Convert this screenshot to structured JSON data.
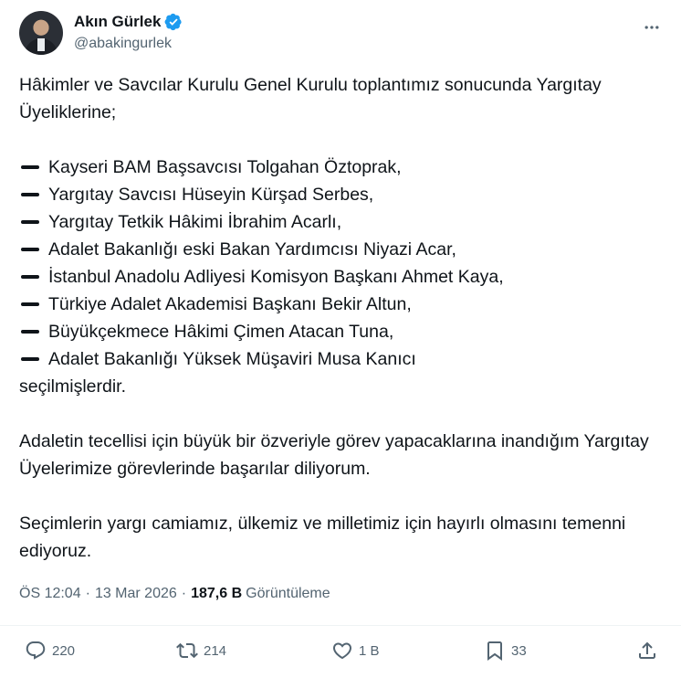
{
  "author": {
    "name": "Akın Gürlek",
    "handle": "@abakingurlek",
    "verified_icon": "verified-badge-icon"
  },
  "tweet": {
    "intro": "Hâkimler ve Savcılar Kurulu Genel Kurulu toplantımız sonucunda Yargıtay Üyeliklerine;",
    "items": [
      "Kayseri BAM Başsavcısı Tolgahan Öztoprak,",
      "Yargıtay Savcısı Hüseyin Kürşad Serbes,",
      "Yargıtay Tetkik Hâkimi İbrahim Acarlı,",
      "Adalet Bakanlığı eski Bakan Yardımcısı Niyazi Acar,",
      "İstanbul Anadolu Adliyesi Komisyon Başkanı Ahmet Kaya,",
      "Türkiye Adalet Akademisi Başkanı Bekir Altun,",
      "Büyükçekmece Hâkimi Çimen Atacan Tuna,",
      "Adalet Bakanlığı Yüksek Müşaviri Musa Kanıcı"
    ],
    "after_list": "seçilmişlerdir.",
    "paragraph2": "Adaletin tecellisi için büyük bir özveriyle görev yapacaklarına inandığım Yargıtay Üyelerimize görevlerinde başarılar diliyorum.",
    "paragraph3": "Seçimlerin yargı camiamız, ülkemiz ve milletimiz için hayırlı olmasını temenni ediyoruz."
  },
  "meta": {
    "time": "ÖS 12:04",
    "date": "13 Mar 2026",
    "views_count": "187,6 B",
    "views_label": "Görüntüleme"
  },
  "actions": {
    "replies": "220",
    "reposts": "214",
    "likes": "1 B",
    "bookmarks": "33"
  },
  "colors": {
    "text": "#0f1419",
    "secondary": "#536471",
    "verified": "#1d9bf0",
    "divider": "#eff3f4"
  }
}
